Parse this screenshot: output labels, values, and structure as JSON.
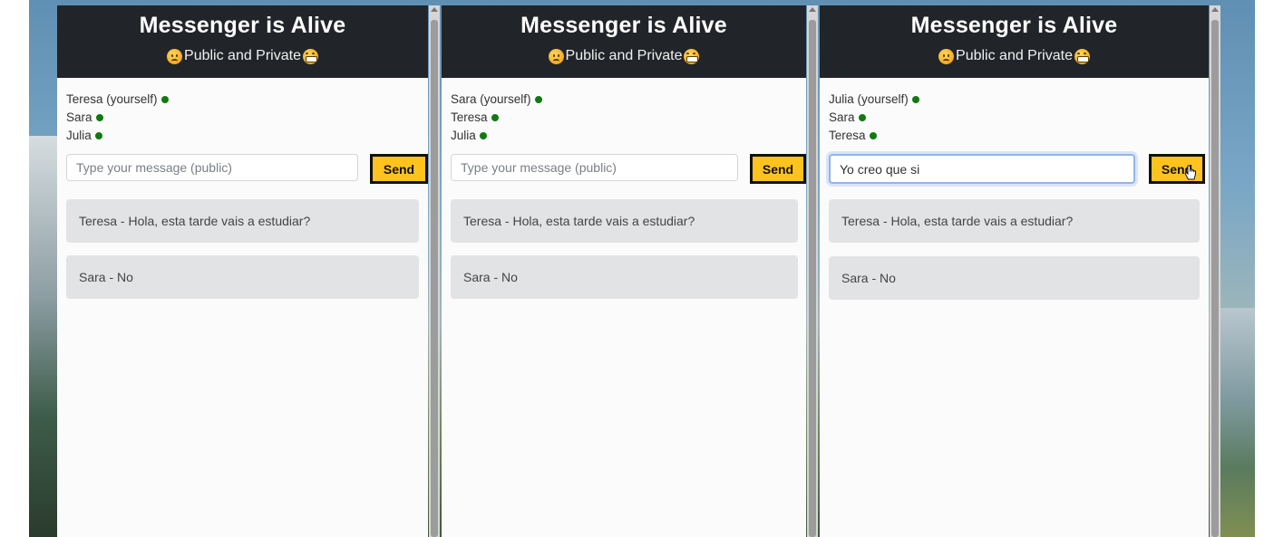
{
  "header": {
    "title": "Messenger is Alive",
    "subtitle": "Public and Private"
  },
  "colors": {
    "header_bg": "#212529",
    "send_bg": "#ffc31f",
    "online_dot": "#107a10",
    "message_bg": "#e2e3e5"
  },
  "windows": [
    {
      "users": [
        "Teresa (yourself)",
        "Sara",
        "Julia"
      ],
      "input_value": "",
      "input_placeholder": "Type your message (public)",
      "send_label": "Send",
      "messages": [
        "Teresa - Hola, esta tarde vais a estudiar?",
        "Sara - No"
      ]
    },
    {
      "users": [
        "Sara (yourself)",
        "Teresa",
        "Julia"
      ],
      "input_value": "",
      "input_placeholder": "Type your message (public)",
      "send_label": "Send",
      "messages": [
        "Teresa - Hola, esta tarde vais a estudiar?",
        "Sara - No"
      ]
    },
    {
      "users": [
        "Julia (yourself)",
        "Sara",
        "Teresa"
      ],
      "input_value": "Yo creo que si",
      "input_placeholder": "Type your message (public)",
      "send_label": "Send",
      "messages": [
        "Teresa - Hola, esta tarde vais a estudiar?",
        "Sara - No"
      ]
    }
  ],
  "icons": {
    "status": "online-dot-icon",
    "subtitle_left": "sad-face-emoji-icon",
    "subtitle_right": "grinning-face-emoji-icon",
    "pointer": "hand-pointer-cursor-icon"
  }
}
